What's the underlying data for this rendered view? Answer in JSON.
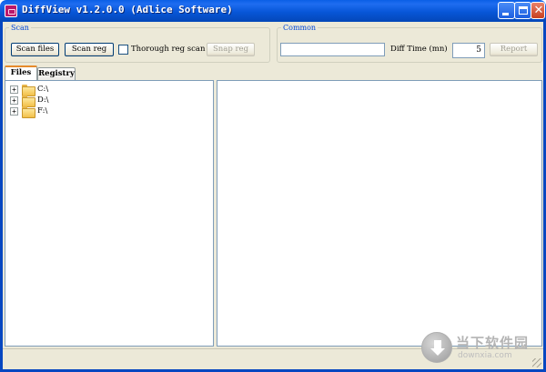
{
  "window": {
    "title": "DiffView v1.2.0.0 (Adlice Software)",
    "accent_color": "#0a5fe6",
    "controls": {
      "close_glyph": "✕"
    }
  },
  "scan": {
    "legend": "Scan",
    "scan_files_label": "Scan files",
    "scan_reg_label": "Scan reg",
    "thorough_label": "Thorough reg scan",
    "thorough_checked": false,
    "snap_reg_label": "Snap reg"
  },
  "common": {
    "legend": "Common",
    "text_value": "",
    "diff_time_label": "Diff Time (mn)",
    "diff_time_value": "5",
    "report_label": "Report"
  },
  "tabs": [
    {
      "label": "Files",
      "active": true
    },
    {
      "label": "Registry",
      "active": false
    }
  ],
  "tree": {
    "items": [
      {
        "label": "C:\\",
        "icon": "folder-icon",
        "expander": "+"
      },
      {
        "label": "D:\\",
        "icon": "folder-icon",
        "expander": "+"
      },
      {
        "label": "F:\\",
        "icon": "folder-icon",
        "expander": "+"
      }
    ]
  },
  "watermark": {
    "title": "当下软件园",
    "subtitle": "downxia.com"
  }
}
